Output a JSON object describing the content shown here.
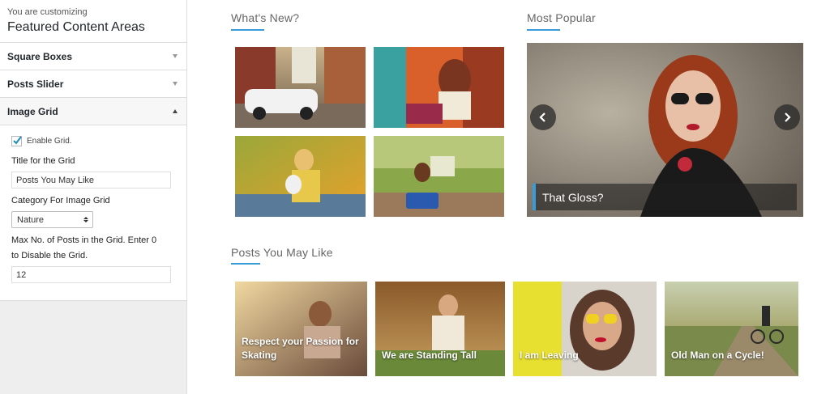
{
  "sidebar": {
    "customizing_prefix": "You are customizing",
    "customizing_title": "Featured Content Areas",
    "sections": [
      {
        "label": "Square Boxes"
      },
      {
        "label": "Posts Slider"
      },
      {
        "label": "Image Grid"
      }
    ],
    "image_grid": {
      "enable_label": "Enable Grid.",
      "enabled": true,
      "title_label": "Title for the Grid",
      "title_value": "Posts You May Like",
      "category_label": "Category For Image Grid",
      "category_value": "Nature",
      "max_label_line1": "Max No. of Posts in the Grid. Enter 0",
      "max_label_line2": "to Disable the Grid.",
      "max_value": "12"
    }
  },
  "main": {
    "whats_new": {
      "heading": "What's New?"
    },
    "most_popular": {
      "heading": "Most Popular",
      "slide_caption": "That Gloss?"
    },
    "posts_you_may_like": {
      "heading": "Posts You May Like",
      "items": [
        {
          "line1": "Respect your Passion for",
          "line2": "Skating"
        },
        {
          "line1": "",
          "line2": "We are Standing Tall"
        },
        {
          "line1": "",
          "line2": "I am Leaving"
        },
        {
          "line1": "",
          "line2": "Old Man on a Cycle!"
        }
      ]
    }
  },
  "colors": {
    "accent": "#3a9bd9",
    "sidebar_bg": "#eeeeee"
  }
}
